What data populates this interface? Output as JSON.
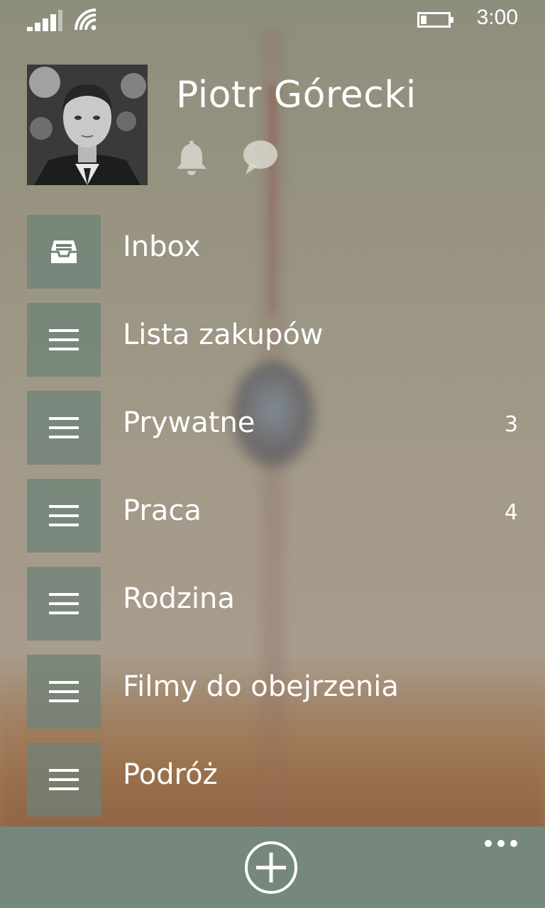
{
  "status_bar": {
    "time": "3:00",
    "icons": [
      "signal-icon",
      "wifi-icon",
      "battery-icon"
    ]
  },
  "profile": {
    "name": "Piotr Górecki",
    "icons": [
      "bell-icon",
      "chat-icon"
    ]
  },
  "lists": [
    {
      "label": "Inbox",
      "count": "",
      "icon": "inbox-icon"
    },
    {
      "label": "Lista zakupów",
      "count": "",
      "icon": "list-icon"
    },
    {
      "label": "Prywatne",
      "count": "3",
      "icon": "list-icon"
    },
    {
      "label": "Praca",
      "count": "4",
      "icon": "list-icon"
    },
    {
      "label": "Rodzina",
      "count": "",
      "icon": "list-icon"
    },
    {
      "label": "Filmy do obejrzenia",
      "count": "",
      "icon": "list-icon"
    },
    {
      "label": "Podróż",
      "count": "",
      "icon": "list-icon"
    }
  ],
  "app_bar": {
    "icons": [
      "add-icon",
      "more-icon"
    ],
    "background": "#76887e"
  },
  "colors": {
    "tile": "#6e8278",
    "text": "#ffffff"
  }
}
